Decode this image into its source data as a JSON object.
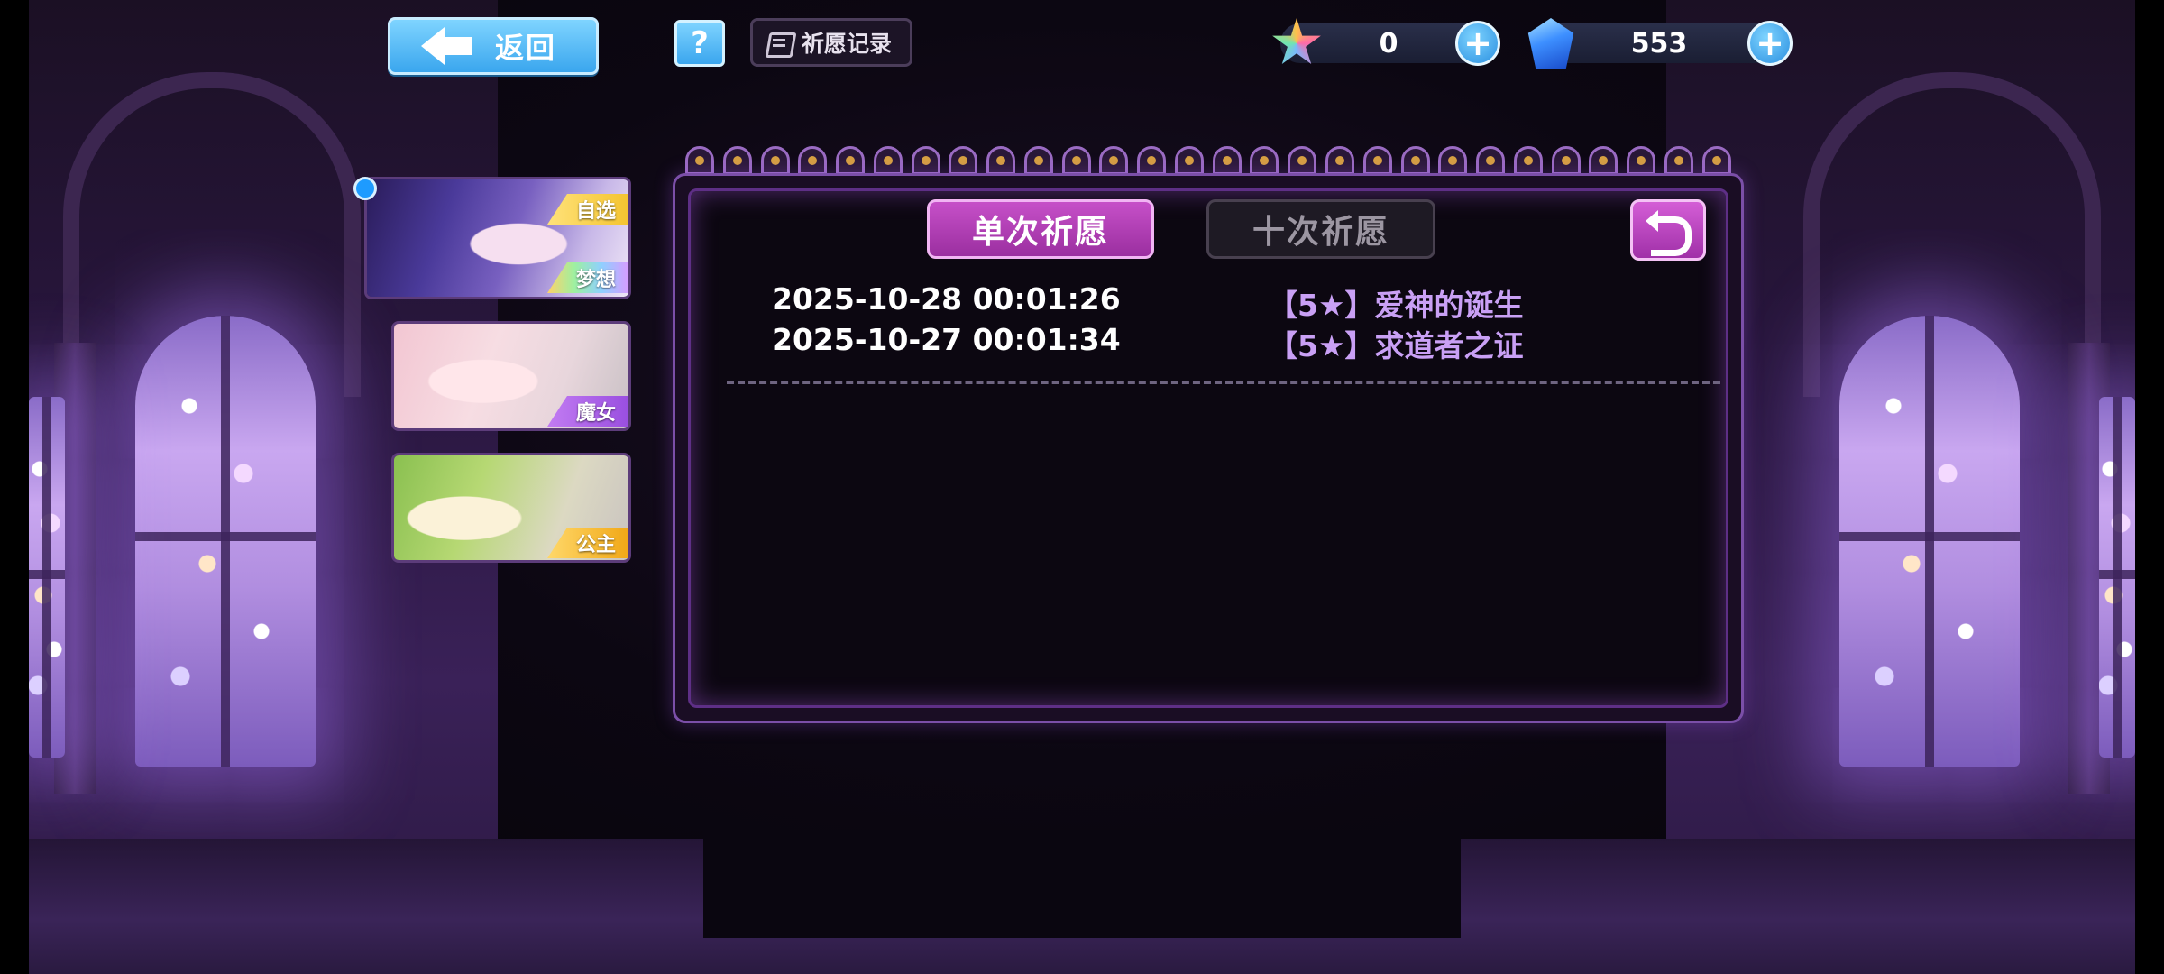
{
  "topbar": {
    "back_label": "返回",
    "help_label": "?",
    "record_label": "祈愿记录"
  },
  "currencies": [
    {
      "icon": "rainbow-star-icon",
      "value": "0"
    },
    {
      "icon": "blue-gem-icon",
      "value": "553"
    }
  ],
  "banners": [
    {
      "top_tag": "自选",
      "bottom_tag": "梦想",
      "selected": true
    },
    {
      "bottom_tag": "魔女"
    },
    {
      "bottom_tag": "公主"
    }
  ],
  "panel": {
    "tabs": [
      {
        "label": "单次祈愿",
        "active": true
      },
      {
        "label": "十次祈愿",
        "active": false
      }
    ],
    "records": [
      {
        "time": "2025-10-28 00:01:26",
        "item": "【5★】爱神的诞生"
      },
      {
        "time": "2025-10-27 00:01:34",
        "item": "【5★】求道者之证"
      }
    ]
  },
  "colors": {
    "accent_blue": "#3aa6ee",
    "tab_active": "#c650c8",
    "item_text": "#c9a0f5",
    "panel_border": "#7b4fa8"
  }
}
